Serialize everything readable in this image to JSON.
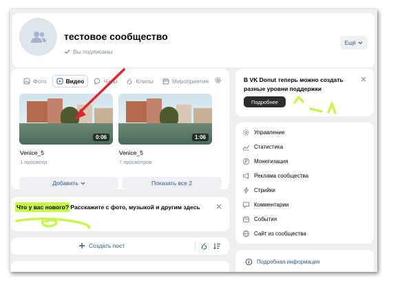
{
  "group": {
    "title": "тестовое сообщество",
    "subscribed_label": "Вы подписаны",
    "more_label": "Ещё"
  },
  "media": {
    "tabs": [
      {
        "label": "Фото",
        "icon": "photo-icon"
      },
      {
        "label": "Видео",
        "icon": "video-icon",
        "active": true
      },
      {
        "label": "Чаты",
        "icon": "chat-icon"
      },
      {
        "label": "Клипы",
        "icon": "clip-icon"
      },
      {
        "label": "Мероприятия",
        "icon": "event-icon"
      }
    ],
    "videos": [
      {
        "title": "Venice_5",
        "views": "1 просмотр",
        "duration": "0:06"
      },
      {
        "title": "Venice_5",
        "views": "7 просмотров",
        "duration": "1:06"
      }
    ],
    "add_label": "Добавить",
    "show_all_label": "Показать все 2"
  },
  "composer": {
    "question": "Что у вас нового?",
    "prompt": " Расскажите с фото, музыкой и другим здесь"
  },
  "create_post": {
    "label": "Создать пост"
  },
  "donut": {
    "text": "В VK Donut теперь можно создать разные уровни поддержки",
    "button_label": "Подробнее"
  },
  "menu": {
    "items": [
      {
        "label": "Управление",
        "icon": "gear-icon"
      },
      {
        "label": "Статистика",
        "icon": "stats-icon"
      },
      {
        "label": "Монетизация",
        "icon": "money-icon"
      },
      {
        "label": "Реклама сообщества",
        "icon": "ads-icon"
      },
      {
        "label": "Стрийки",
        "icon": "lightning-icon"
      },
      {
        "label": "Комментарии",
        "icon": "comment-icon"
      },
      {
        "label": "События",
        "icon": "event-icon"
      },
      {
        "label": "Сайт из сообщества",
        "icon": "globe-icon"
      }
    ]
  },
  "info": {
    "label": "Подробная информация"
  },
  "colors": {
    "accent": "#2d5a8c",
    "highlight": "#c8f54a",
    "arrow": "#e3242b",
    "page_bg": "#edeef0"
  }
}
